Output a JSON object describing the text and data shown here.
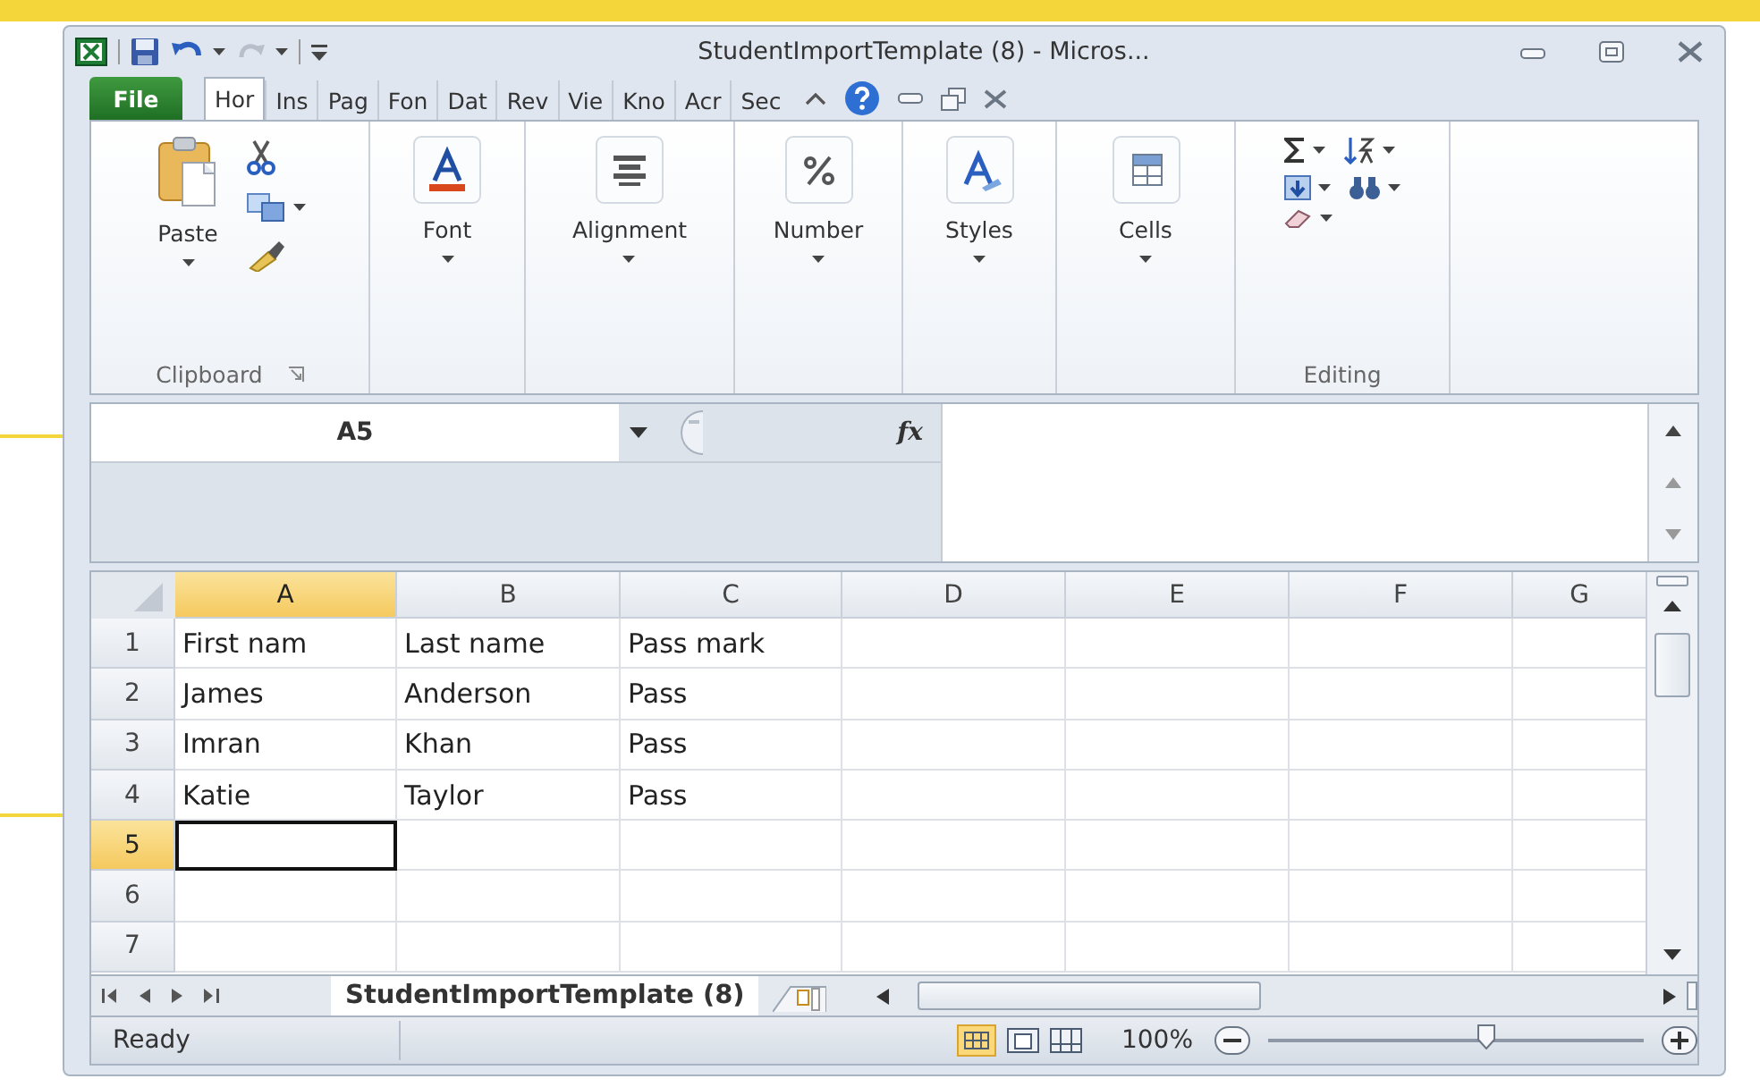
{
  "window": {
    "title": "StudentImportTemplate (8) - Micros..."
  },
  "tabs": [
    {
      "label": "File",
      "kind": "file",
      "selected": false
    },
    {
      "label": "Hor",
      "kind": "tab",
      "selected": true
    },
    {
      "label": "Ins",
      "kind": "tab",
      "selected": false
    },
    {
      "label": "Pag",
      "kind": "tab",
      "selected": false
    },
    {
      "label": "Fon",
      "kind": "tab",
      "selected": false
    },
    {
      "label": "Dat",
      "kind": "tab",
      "selected": false
    },
    {
      "label": "Rev",
      "kind": "tab",
      "selected": false
    },
    {
      "label": "Vie",
      "kind": "tab",
      "selected": false
    },
    {
      "label": "Kno",
      "kind": "tab",
      "selected": false
    },
    {
      "label": "Acr",
      "kind": "tab",
      "selected": false
    },
    {
      "label": "Sec",
      "kind": "tab",
      "selected": false
    }
  ],
  "ribbon": {
    "groups": [
      {
        "kind": "clipboard",
        "button": "Paste",
        "name": "Clipboard"
      },
      {
        "kind": "font",
        "button": "Font"
      },
      {
        "kind": "alignment",
        "button": "Alignment"
      },
      {
        "kind": "number",
        "button": "Number"
      },
      {
        "kind": "styles",
        "button": "Styles"
      },
      {
        "kind": "cells",
        "button": "Cells"
      },
      {
        "kind": "editing",
        "name": "Editing"
      }
    ]
  },
  "formula_bar": {
    "name_box": "A5",
    "function_label": "fx"
  },
  "grid": {
    "columns": [
      {
        "label": "A",
        "selected": true
      },
      {
        "label": "B",
        "selected": false
      },
      {
        "label": "C",
        "selected": false
      },
      {
        "label": "D",
        "selected": false
      },
      {
        "label": "E",
        "selected": false
      },
      {
        "label": "F",
        "selected": false
      },
      {
        "label": "G",
        "selected": false
      }
    ],
    "rows": [
      {
        "header": "1",
        "selected": false,
        "cells": [
          "First nam",
          "Last name",
          "Pass mark"
        ]
      },
      {
        "header": "2",
        "selected": false,
        "cells": [
          "James",
          "Anderson",
          "Pass"
        ]
      },
      {
        "header": "3",
        "selected": false,
        "cells": [
          "Imran",
          "Khan",
          "Pass"
        ]
      },
      {
        "header": "4",
        "selected": false,
        "cells": [
          "Katie",
          "Taylor",
          "Pass"
        ]
      },
      {
        "header": "5",
        "selected": true,
        "cells": []
      },
      {
        "header": "6",
        "selected": false,
        "cells": []
      },
      {
        "header": "7",
        "selected": false,
        "cells": []
      }
    ]
  },
  "sheet_tabs": [
    {
      "label": "StudentImportTemplate (8)",
      "selected": true
    }
  ],
  "status_bar": {
    "text": "Ready",
    "zoom": "100%",
    "zoom_slider": {
      "level": 0.58
    }
  }
}
